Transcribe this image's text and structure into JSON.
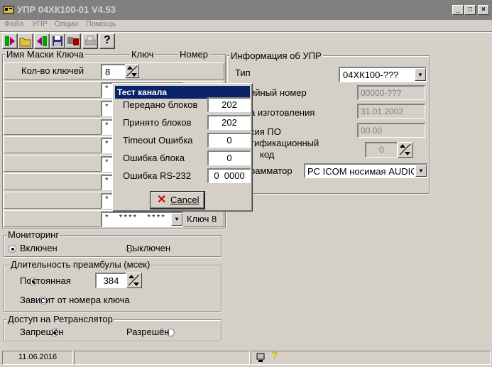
{
  "window": {
    "title": "УПР 04ХК100-01",
    "version": "V4.53",
    "ctrl": {
      "min": "_",
      "max": "□",
      "close": "×"
    }
  },
  "menu": [
    "Файл",
    "УПР",
    "Опции",
    "Помощь"
  ],
  "toolbar": {
    "help_glyph": "?"
  },
  "keys_header": {
    "name": "Имя Маски Ключа",
    "key": "Ключ",
    "number": "Номер"
  },
  "keys_count": {
    "label": "Кол-во ключей",
    "value": "8"
  },
  "keys_rows": [
    {
      "mask": "*"
    },
    {
      "mask": "*"
    },
    {
      "mask": "*"
    },
    {
      "mask": "*"
    },
    {
      "mask": "*"
    },
    {
      "mask": "*"
    },
    {
      "mask": "*"
    },
    {
      "mask": "*  ****  ****",
      "label": "Ключ 8"
    }
  ],
  "upr_info": {
    "title": "Информация об УПР",
    "type_label": "Тип",
    "type_value": "04ХК100-???",
    "serial_label": "ийный номер",
    "serial_value": "00000-???",
    "date_label": "а изготовления",
    "date_value": "31.01.2002",
    "po_label": "сия ПО",
    "po_value": "00.00",
    "ident_label1": "тификационный",
    "ident_label2": "код",
    "ident_value": "0",
    "prog_label": "рамматор",
    "prog_value": "PC ICOM носимая AUDIO"
  },
  "monitoring": {
    "title": "Мониторинг",
    "on": "Включен",
    "off": "Выключен",
    "selected": "on"
  },
  "preamble": {
    "title": "Длительность преамбулы (мсек)",
    "constant": "Постоянная",
    "constant_value": "384",
    "depends": "Зависит от номера ключа",
    "selected": "constant"
  },
  "relay": {
    "title": "Доступ на Ретранслятор",
    "deny": "Запрешён",
    "allow": "Разрешён",
    "selected": "deny"
  },
  "status": {
    "date": "11.06.2016",
    "help_glyph": "?"
  },
  "dialog": {
    "title": "Тест канала",
    "rows": [
      {
        "label": "Передано блоков",
        "value": "202"
      },
      {
        "label": "Принято блоков",
        "value": "202"
      },
      {
        "label": "Timeout Ошибка",
        "value": "0"
      },
      {
        "label": "Ошибка блока",
        "value": "0"
      },
      {
        "label": "Ошибка RS-232",
        "value": "0  0000"
      }
    ],
    "cancel_label": "Cancel"
  },
  "colors": {
    "dialog_title_bg": "#0a246a",
    "inactive_title_bg": "#808080",
    "cancel_x": "#d40000"
  }
}
